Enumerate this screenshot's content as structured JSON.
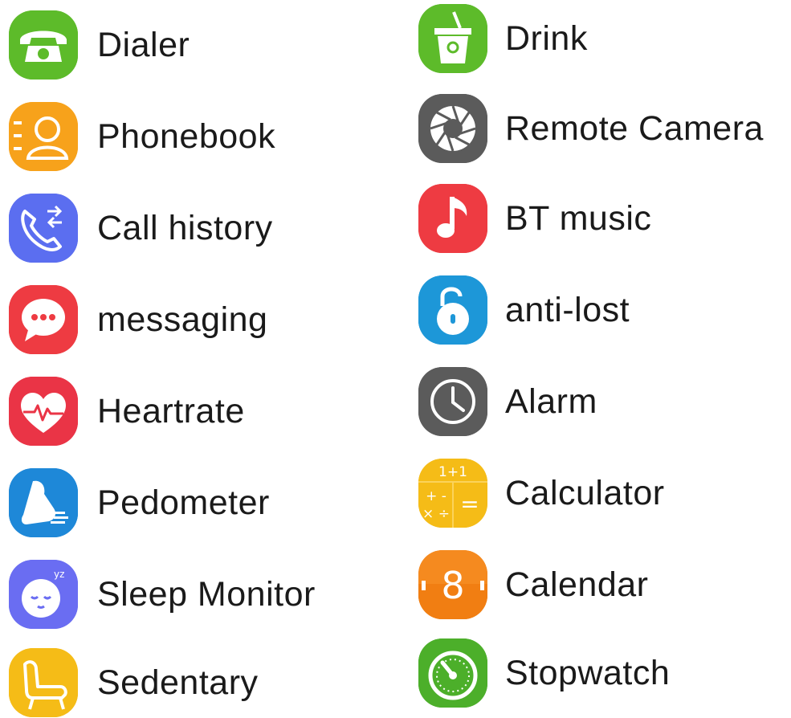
{
  "left_column": [
    {
      "label": "Dialer",
      "icon": "phone-icon",
      "color": "#5dbb2a"
    },
    {
      "label": "Phonebook",
      "icon": "contacts-icon",
      "color": "#f7a21b"
    },
    {
      "label": "Call history",
      "icon": "call-history-icon",
      "color": "#5b6ef0"
    },
    {
      "label": "messaging",
      "icon": "chat-bubble-icon",
      "color": "#ee3b42"
    },
    {
      "label": "Heartrate",
      "icon": "heart-pulse-icon",
      "color": "#ea3446"
    },
    {
      "label": "Pedometer",
      "icon": "running-shoe-icon",
      "color": "#1e88d8"
    },
    {
      "label": "Sleep Monitor",
      "icon": "sleeping-face-icon",
      "color": "#6a6df2"
    },
    {
      "label": "Sedentary",
      "icon": "chair-icon",
      "color": "#f5bc17"
    }
  ],
  "right_column": [
    {
      "label": "Drink",
      "icon": "cup-icon",
      "color": "#5dbb2a"
    },
    {
      "label": "Remote Camera",
      "icon": "camera-aperture-icon",
      "color": "#5b5b5b"
    },
    {
      "label": "BT music",
      "icon": "music-note-icon",
      "color": "#ee3b42"
    },
    {
      "label": "anti-lost",
      "icon": "unlocked-padlock-icon",
      "color": "#1d97d8"
    },
    {
      "label": "Alarm",
      "icon": "clock-icon",
      "color": "#5b5b5b"
    },
    {
      "label": "Calculator",
      "icon": "calculator-icon",
      "color": "#f5bc17"
    },
    {
      "label": "Calendar",
      "icon": "calendar-icon",
      "color": "#f58a1f"
    },
    {
      "label": "Stopwatch",
      "icon": "stopwatch-icon",
      "color": "#4caf2a"
    }
  ],
  "calculator_icon_text": {
    "top": "1+1",
    "ops": "+ -",
    "ops2": "× ÷",
    "equals": "="
  },
  "calendar_icon_text": "8"
}
